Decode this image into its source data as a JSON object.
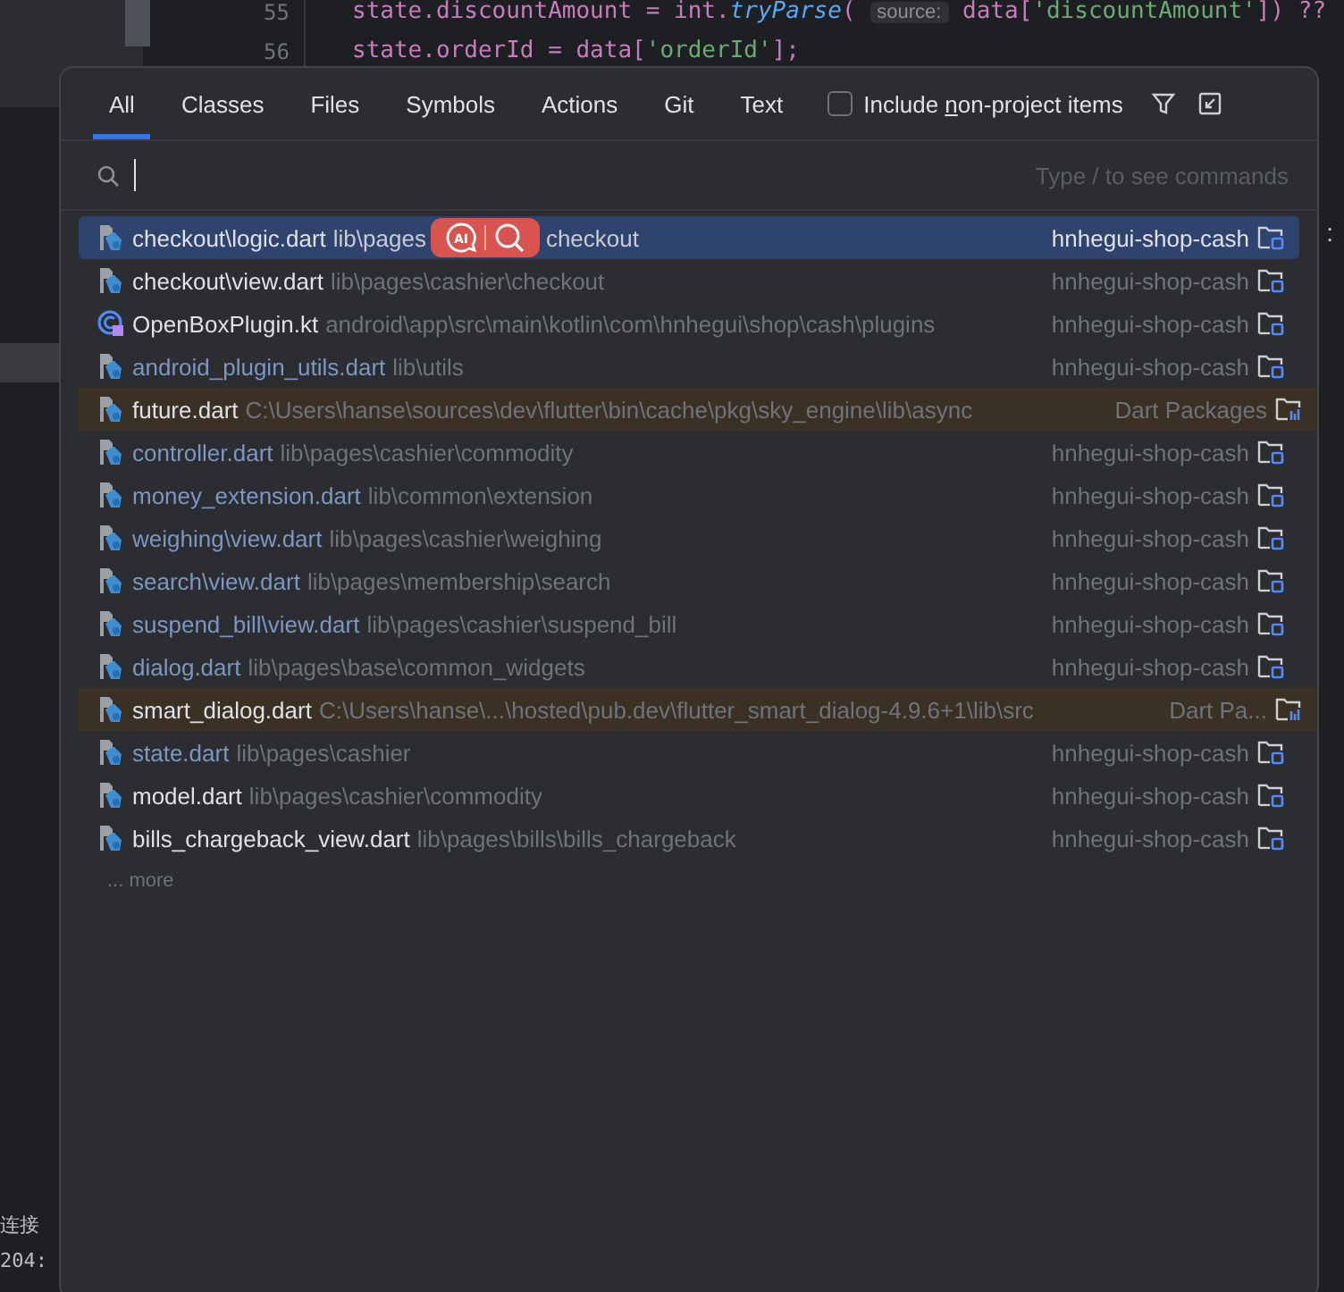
{
  "editor": {
    "lines": [
      {
        "number": "55",
        "parts": [
          {
            "kind": "code",
            "text": "state.discountAmount = int."
          },
          {
            "kind": "call",
            "text": "tryParse"
          },
          {
            "kind": "code",
            "text": "( "
          },
          {
            "kind": "hint",
            "text": "source:"
          },
          {
            "kind": "code",
            "text": " data["
          },
          {
            "kind": "string",
            "text": "'discountAmount'"
          },
          {
            "kind": "code",
            "text": "]) ??"
          }
        ]
      },
      {
        "number": "56",
        "parts": [
          {
            "kind": "code",
            "text": "state.orderId = data["
          },
          {
            "kind": "string",
            "text": "'orderId'"
          },
          {
            "kind": "code",
            "text": "];"
          }
        ]
      }
    ],
    "side_mark": ":",
    "console": [
      "连接",
      "204:"
    ]
  },
  "popup": {
    "tabs": [
      {
        "label": "All",
        "selected": true
      },
      {
        "label": "Classes",
        "selected": false
      },
      {
        "label": "Files",
        "selected": false
      },
      {
        "label": "Symbols",
        "selected": false
      },
      {
        "label": "Actions",
        "selected": false
      },
      {
        "label": "Git",
        "selected": false
      },
      {
        "label": "Text",
        "selected": false
      }
    ],
    "include_option": {
      "label_parts": [
        {
          "text": "Include ",
          "underlined": false
        },
        {
          "text": "n",
          "underlined": true
        },
        {
          "text": "on-project items",
          "underlined": false
        }
      ],
      "checked": false
    },
    "selection_toolbar": {
      "ai_label": "AI"
    },
    "search": {
      "placeholder": "Type / to see commands"
    },
    "results": [
      {
        "name": "checkout\\logic.dart",
        "path": "lib\\pages",
        "path_tail": "checkout",
        "location": "hnhegui-shop-cash",
        "kind": "dart",
        "non_project": false,
        "modified": false,
        "selected": true
      },
      {
        "name": "checkout\\view.dart",
        "path": "lib\\pages\\cashier\\checkout",
        "location": "hnhegui-shop-cash",
        "kind": "dart",
        "non_project": false,
        "modified": false,
        "selected": false
      },
      {
        "name": "OpenBoxPlugin.kt",
        "path": "android\\app\\src\\main\\kotlin\\com\\hnhegui\\shop\\cash\\plugins",
        "location": "hnhegui-shop-cash",
        "kind": "kotlin",
        "non_project": false,
        "modified": false,
        "selected": false
      },
      {
        "name": "android_plugin_utils.dart",
        "path": "lib\\utils",
        "location": "hnhegui-shop-cash",
        "kind": "dart",
        "non_project": false,
        "modified": true,
        "selected": false
      },
      {
        "name": "future.dart",
        "path": "C:\\Users\\hanse\\sources\\dev\\flutter\\bin\\cache\\pkg\\sky_engine\\lib\\async",
        "location": "Dart Packages",
        "kind": "dart",
        "non_project": true,
        "modified": false,
        "selected": false
      },
      {
        "name": "controller.dart",
        "path": "lib\\pages\\cashier\\commodity",
        "location": "hnhegui-shop-cash",
        "kind": "dart",
        "non_project": false,
        "modified": true,
        "selected": false
      },
      {
        "name": "money_extension.dart",
        "path": "lib\\common\\extension",
        "location": "hnhegui-shop-cash",
        "kind": "dart",
        "non_project": false,
        "modified": true,
        "selected": false
      },
      {
        "name": "weighing\\view.dart",
        "path": "lib\\pages\\cashier\\weighing",
        "location": "hnhegui-shop-cash",
        "kind": "dart",
        "non_project": false,
        "modified": true,
        "selected": false
      },
      {
        "name": "search\\view.dart",
        "path": "lib\\pages\\membership\\search",
        "location": "hnhegui-shop-cash",
        "kind": "dart",
        "non_project": false,
        "modified": true,
        "selected": false
      },
      {
        "name": "suspend_bill\\view.dart",
        "path": "lib\\pages\\cashier\\suspend_bill",
        "location": "hnhegui-shop-cash",
        "kind": "dart",
        "non_project": false,
        "modified": true,
        "selected": false
      },
      {
        "name": "dialog.dart",
        "path": "lib\\pages\\base\\common_widgets",
        "location": "hnhegui-shop-cash",
        "kind": "dart",
        "non_project": false,
        "modified": true,
        "selected": false
      },
      {
        "name": "smart_dialog.dart",
        "path": "C:\\Users\\hanse\\...\\hosted\\pub.dev\\flutter_smart_dialog-4.9.6+1\\lib\\src",
        "location": "Dart Pa...",
        "kind": "dart",
        "non_project": true,
        "modified": false,
        "selected": false
      },
      {
        "name": "state.dart",
        "path": "lib\\pages\\cashier",
        "location": "hnhegui-shop-cash",
        "kind": "dart",
        "non_project": false,
        "modified": true,
        "selected": false
      },
      {
        "name": "model.dart",
        "path": "lib\\pages\\cashier\\commodity",
        "location": "hnhegui-shop-cash",
        "kind": "dart",
        "non_project": false,
        "modified": false,
        "selected": false
      },
      {
        "name": "bills_chargeback_view.dart",
        "path": "lib\\pages\\bills\\bills_chargeback",
        "location": "hnhegui-shop-cash",
        "kind": "dart",
        "non_project": false,
        "modified": false,
        "selected": false
      }
    ],
    "more": "... more"
  }
}
